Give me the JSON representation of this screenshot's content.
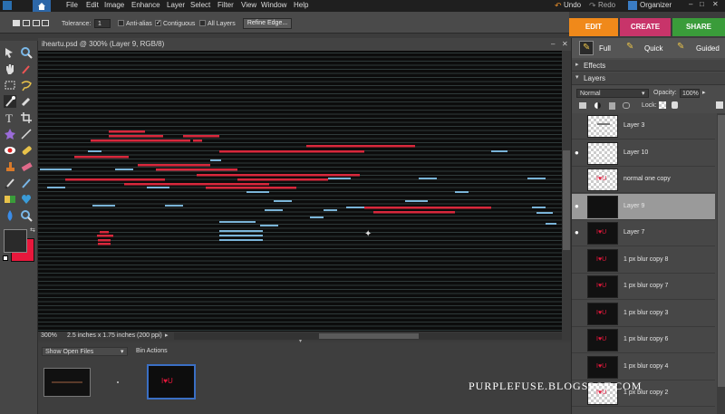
{
  "menubar": {
    "items": [
      "File",
      "Edit",
      "Image",
      "Enhance",
      "Layer",
      "Select",
      "Filter",
      "View",
      "Window",
      "Help"
    ],
    "undo_label": "Undo",
    "redo_label": "Redo",
    "organizer_label": "Organizer"
  },
  "options_bar": {
    "tolerance_label": "Tolerance:",
    "tolerance_value": "1",
    "anti_alias_label": "Anti-alias",
    "contiguous_label": "Contiguous",
    "all_layers_label": "All Layers",
    "refine_edge_label": "Refine Edge..."
  },
  "mode_tabs": {
    "edit": "EDIT",
    "create": "CREATE",
    "share": "SHARE",
    "colors": {
      "edit": "#f0891a",
      "create": "#c8346a",
      "share": "#3a9c3a"
    }
  },
  "edit_modes": {
    "full": "Full",
    "quick": "Quick",
    "guided": "Guided"
  },
  "document": {
    "title": "iheartu.psd @ 300% (Layer 9, RGB/8)",
    "zoom": "300%",
    "info": "2.5 inches x 1.75 inches (200 ppi)"
  },
  "bin": {
    "show_label": "Show Open Files",
    "actions_label": "Bin Actions"
  },
  "panels": {
    "effects_label": "Effects",
    "layers_label": "Layers",
    "blend_mode": "Normal",
    "opacity_label": "Opacity:",
    "opacity_value": "100%",
    "lock_label": "Lock:"
  },
  "layers": [
    {
      "name": "Layer 3",
      "thumb": "checker-text",
      "visible": false
    },
    {
      "name": "Layer 10",
      "thumb": "checker",
      "visible": true
    },
    {
      "name": "normal one copy",
      "thumb": "checker-heart",
      "visible": false
    },
    {
      "name": "Layer 9",
      "thumb": "dark",
      "visible": true,
      "selected": true
    },
    {
      "name": "Layer 7",
      "thumb": "dark-heart",
      "visible": true
    },
    {
      "name": "1 px blur copy 8",
      "thumb": "dark-heart",
      "visible": false
    },
    {
      "name": "1 px blur copy 7",
      "thumb": "dark-heart",
      "visible": false
    },
    {
      "name": "1 px blur copy 3",
      "thumb": "dark-heart",
      "visible": false
    },
    {
      "name": "1 px blur copy 6",
      "thumb": "dark-heart",
      "visible": false
    },
    {
      "name": "1 px blur copy 4",
      "thumb": "dark-heart",
      "visible": false
    },
    {
      "name": "1 px blur copy 2",
      "thumb": "checker-heart",
      "visible": false
    }
  ],
  "watermark": "PURPLEFUSE.BLOGSPOT.COM",
  "icons": {
    "home": "home-icon",
    "undo": "undo-icon",
    "redo": "redo-icon",
    "organizer": "organizer-icon",
    "eye": "eye-icon"
  }
}
